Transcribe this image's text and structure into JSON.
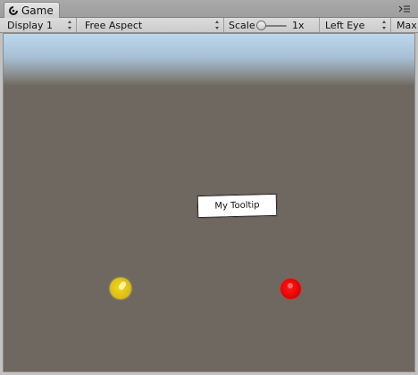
{
  "window": {
    "tab_title": "Game",
    "tab_icon": "game-controller-icon",
    "menu_icon": "panel-menu-icon"
  },
  "toolbar": {
    "display_label": "Display 1",
    "aspect_label": "Free Aspect",
    "scale_label": "Scale",
    "scale_value": "1x",
    "eye_label": "Left Eye",
    "max_label": "Max"
  },
  "game_view": {
    "tooltip_text": "My Tooltip",
    "objects": [
      {
        "name": "yellow-circle",
        "color": "#e1c51a"
      },
      {
        "name": "red-circle",
        "color": "#f21010"
      }
    ]
  }
}
